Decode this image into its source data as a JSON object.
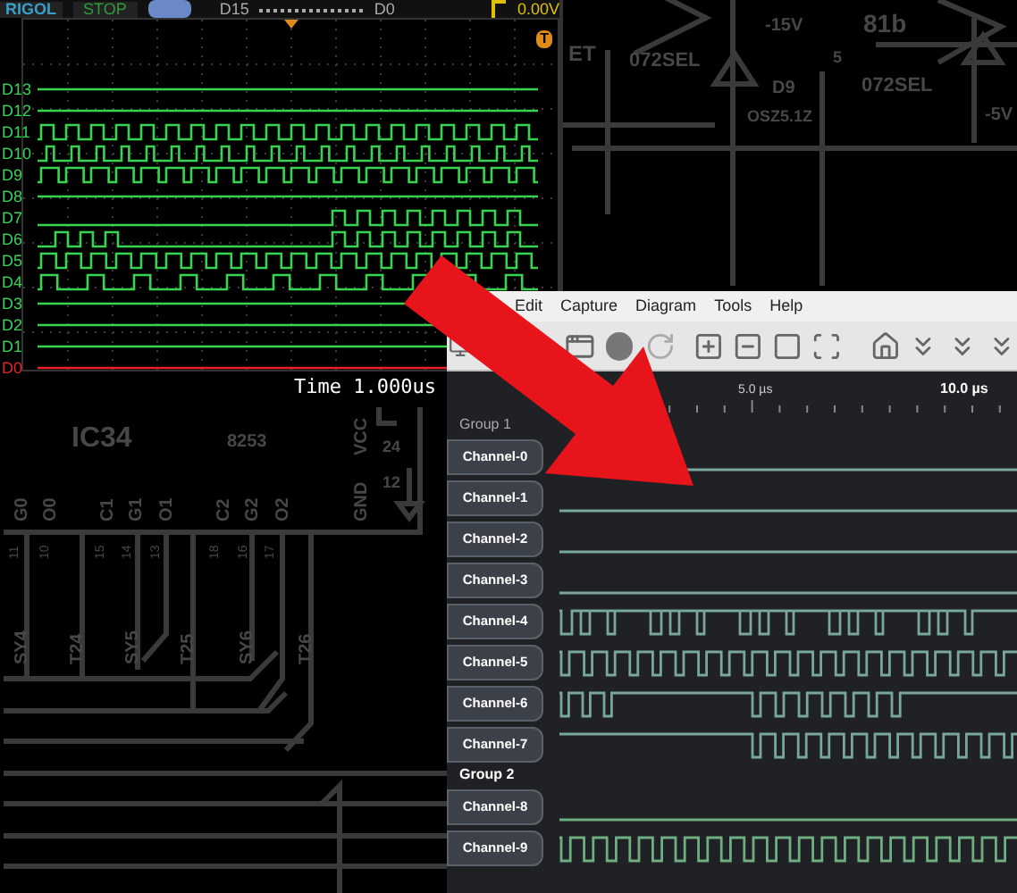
{
  "schematic": {
    "labels": [
      "IC34",
      "8253",
      "VCC",
      "GND",
      "24",
      "12",
      "G0",
      "O0",
      "C1",
      "G1",
      "O1",
      "C2",
      "G2",
      "O2",
      "11",
      "10",
      "15",
      "14",
      "13",
      "18",
      "16",
      "17",
      "SY4",
      "T24",
      "SY5",
      "T25",
      "SY6",
      "T26",
      "ET",
      "072SEL",
      "-15V",
      "D9",
      "OSZ5.1Z",
      "072SEL",
      "5",
      "-5V",
      "81b"
    ]
  },
  "oscilloscope": {
    "brand": "RIGOL",
    "run_state": "STOP",
    "range_start": "D15",
    "range_end": "D0",
    "trigger_level": "0.00V",
    "trigger_marker": "T",
    "timebase": "Time 1.000us",
    "channels": [
      {
        "label": "D13",
        "kind": "flat",
        "color": "#39d353"
      },
      {
        "label": "D12",
        "kind": "flat",
        "color": "#39d353"
      },
      {
        "label": "D11",
        "kind": "signal",
        "color": "#39d353"
      },
      {
        "label": "D10",
        "kind": "signal",
        "color": "#39d353"
      },
      {
        "label": "D9",
        "kind": "signal",
        "color": "#39d353"
      },
      {
        "label": "D8",
        "kind": "flat",
        "color": "#39d353"
      },
      {
        "label": "D7",
        "kind": "signal",
        "color": "#39d353"
      },
      {
        "label": "D6",
        "kind": "signal",
        "color": "#39d353"
      },
      {
        "label": "D5",
        "kind": "signal",
        "color": "#39d353"
      },
      {
        "label": "D4",
        "kind": "signal",
        "color": "#39d353"
      },
      {
        "label": "D3",
        "kind": "flat",
        "color": "#39d353"
      },
      {
        "label": "D2",
        "kind": "flat",
        "color": "#39d353"
      },
      {
        "label": "D1",
        "kind": "flat",
        "color": "#39d353"
      },
      {
        "label": "D0",
        "kind": "flat",
        "color": "#e8202a"
      }
    ]
  },
  "analyzer": {
    "menu": [
      "Edit",
      "Capture",
      "Diagram",
      "Tools",
      "Help"
    ],
    "ruler": [
      "5.0 µs",
      "10.0 µs"
    ],
    "groups": [
      {
        "label": "Group 1",
        "channels": [
          {
            "label": "Channel-0",
            "kind": "flat"
          },
          {
            "label": "Channel-1",
            "kind": "flat"
          },
          {
            "label": "Channel-2",
            "kind": "flat"
          },
          {
            "label": "Channel-3",
            "kind": "flat"
          },
          {
            "label": "Channel-4",
            "kind": "signal"
          },
          {
            "label": "Channel-5",
            "kind": "signal"
          },
          {
            "label": "Channel-6",
            "kind": "signal"
          },
          {
            "label": "Channel-7",
            "kind": "signal"
          }
        ]
      },
      {
        "label": "Group 2",
        "channels": [
          {
            "label": "Channel-8",
            "kind": "flat"
          },
          {
            "label": "Channel-9",
            "kind": "signal"
          }
        ]
      }
    ]
  }
}
